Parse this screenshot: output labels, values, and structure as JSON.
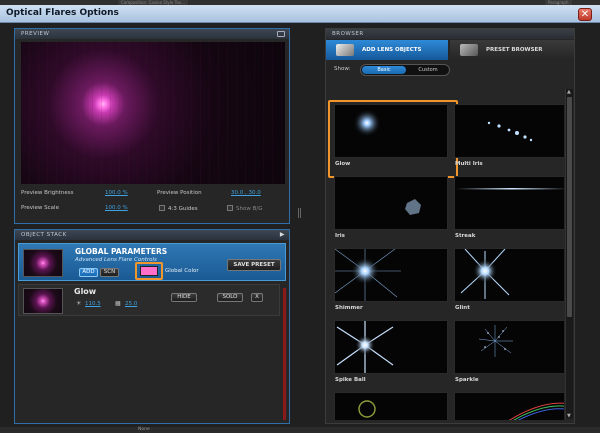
{
  "host": {
    "tabs": [
      "Composition: Casino Style Tex...",
      "Paragraph"
    ],
    "bottom_value": "None"
  },
  "window": {
    "title": "Optical Flares Options",
    "close_label": "✕"
  },
  "preview": {
    "header": "PREVIEW",
    "brightness_label": "Preview Brightness",
    "brightness_value": "100.0 %",
    "position_label": "Preview Position",
    "position_value": "30.0 , 30.0",
    "scale_label": "Preview Scale",
    "scale_value": "100.0 %",
    "guides_label": "4:3 Guides",
    "show_bg_label": "Show B/G"
  },
  "object_stack": {
    "header": "OBJECT STACK",
    "global": {
      "title": "GLOBAL PARAMETERS",
      "subtitle": "Advanced Lens Flare Controls",
      "add_label": "ADD",
      "scn_label": "SCN",
      "color_label": "Global Color",
      "color": "#ff6ec9",
      "save_preset_label": "SAVE PRESET"
    },
    "items": [
      {
        "name": "Glow",
        "brightness": "110.5",
        "scale": "25.0",
        "hide_label": "HIDE",
        "solo_label": "SOLO",
        "delete_label": "X"
      }
    ]
  },
  "browser": {
    "header": "BROWSER",
    "tab_add_label": "ADD LENS OBJECTS",
    "tab_preset_label": "PRESET BROWSER",
    "show_label": "Show:",
    "show_basic": "Basic",
    "show_custom": "Custom",
    "lens_objects": [
      "Glow",
      "Multi Iris",
      "Iris",
      "Streak",
      "Shimmer",
      "Glint",
      "Spike Ball",
      "Sparkle"
    ],
    "selected": "Glow"
  },
  "colors": {
    "accent": "#2e8ad8",
    "highlight": "#f0962a",
    "flare": "#ff6fe4"
  }
}
